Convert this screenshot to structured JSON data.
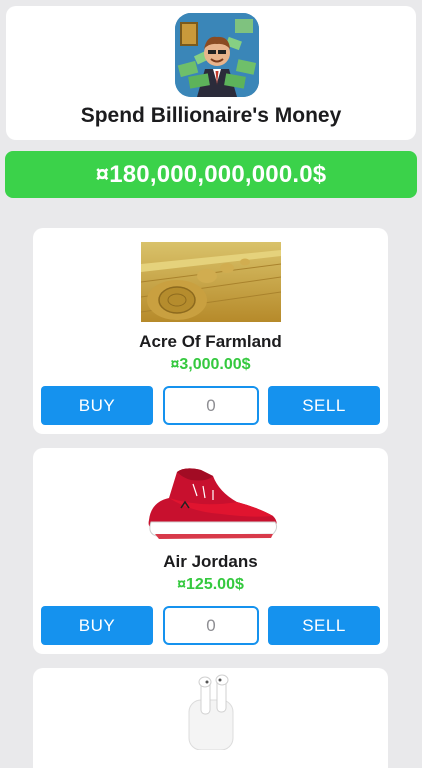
{
  "app": {
    "title": "Spend Billionaire's Money",
    "icon": "billionaire-app-icon"
  },
  "balance": {
    "text": "¤180,000,000,000.0$",
    "color": "#3bd24a"
  },
  "items": [
    {
      "name": "Acre Of Farmland",
      "price": "¤3,000.00$",
      "image": "hay-bales-field-image",
      "buy_label": "BUY",
      "quantity": "0",
      "sell_label": "SELL"
    },
    {
      "name": "Air Jordans",
      "price": "¤125.00$",
      "image": "red-sneaker-image",
      "buy_label": "BUY",
      "quantity": "0",
      "sell_label": "SELL"
    },
    {
      "image": "airpods-image"
    }
  ],
  "colors": {
    "accent": "#1592ee",
    "price": "#35c93f",
    "background": "#e9e9eb"
  }
}
